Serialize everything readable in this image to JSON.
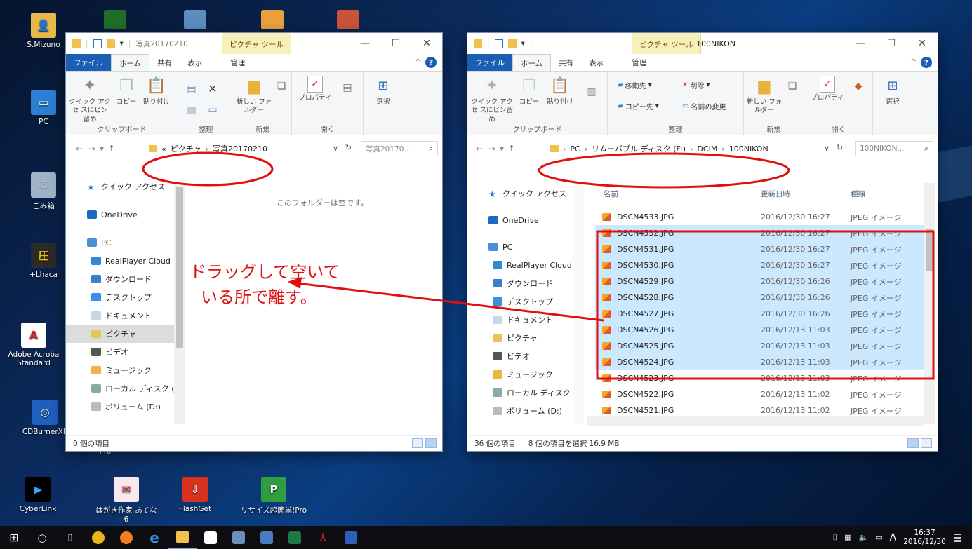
{
  "desktop": {
    "icons": [
      {
        "label": "S.Mizuno"
      },
      {
        "label": "PC"
      },
      {
        "label": "ごみ箱"
      },
      {
        "label": "+Lhaca"
      },
      {
        "label": "Adobe Acroba Standard"
      },
      {
        "label": "CDBurnerXP"
      },
      {
        "label": "CyberLink"
      },
      {
        "label": "はがき作家 あてな 6"
      },
      {
        "label": "FlashGet"
      },
      {
        "label": "リサイズ超簡単!Pro"
      }
    ],
    "icon_overlap_text": "Pro"
  },
  "left_window": {
    "title": "写真20170210",
    "context_tab": "ピクチャ ツール",
    "tabs": [
      "ファイル",
      "ホーム",
      "共有",
      "表示",
      "管理"
    ],
    "ribbon": {
      "pin": "クイック アクセ スにピン留め",
      "copy": "コピー",
      "paste": "貼り付け",
      "new_folder": "新しい フォルダー",
      "properties": "プロパティ",
      "select": "選択",
      "groups": [
        "クリップボード",
        "整理",
        "新規",
        "開く"
      ]
    },
    "breadcrumb": [
      "«",
      "ピクチャ",
      "写真20170210"
    ],
    "search_placeholder": "写真20170...",
    "empty_message": "このフォルダーは空です。",
    "status": "0 個の項目"
  },
  "right_window": {
    "title": "100NIKON",
    "context_tab": "ピクチャ ツール",
    "tabs": [
      "ファイル",
      "ホーム",
      "共有",
      "表示",
      "管理"
    ],
    "ribbon": {
      "pin": "クイック アクセ スにピン留め",
      "copy": "コピー",
      "paste": "貼り付け",
      "move_to": "移動先",
      "delete": "削除",
      "copy_to": "コピー先",
      "rename": "名前の変更",
      "new_folder": "新しい フォルダー",
      "properties": "プロパティ",
      "select": "選択",
      "groups": [
        "クリップボード",
        "整理",
        "新規",
        "開く"
      ]
    },
    "breadcrumb": [
      "PC",
      "リムーバブル ディスク (F:)",
      "DCIM",
      "100NIKON"
    ],
    "search_placeholder": "100NIKON...",
    "columns": [
      "名前",
      "更新日時",
      "種類"
    ],
    "files": [
      {
        "name": "DSCN4533.JPG",
        "date": "2016/12/30 16:27",
        "type": "JPEG イメージ",
        "selected": false
      },
      {
        "name": "DSCN4532.JPG",
        "date": "2016/12/30 16:27",
        "type": "JPEG イメージ",
        "selected": true
      },
      {
        "name": "DSCN4531.JPG",
        "date": "2016/12/30 16:27",
        "type": "JPEG イメージ",
        "selected": true
      },
      {
        "name": "DSCN4530.JPG",
        "date": "2016/12/30 16:27",
        "type": "JPEG イメージ",
        "selected": true
      },
      {
        "name": "DSCN4529.JPG",
        "date": "2016/12/30 16:26",
        "type": "JPEG イメージ",
        "selected": true
      },
      {
        "name": "DSCN4528.JPG",
        "date": "2016/12/30 16:26",
        "type": "JPEG イメージ",
        "selected": true
      },
      {
        "name": "DSCN4527.JPG",
        "date": "2016/12/30 16:26",
        "type": "JPEG イメージ",
        "selected": true
      },
      {
        "name": "DSCN4526.JPG",
        "date": "2016/12/13 11:03",
        "type": "JPEG イメージ",
        "selected": true
      },
      {
        "name": "DSCN4525.JPG",
        "date": "2016/12/13 11:03",
        "type": "JPEG イメージ",
        "selected": true
      },
      {
        "name": "DSCN4524.JPG",
        "date": "2016/12/13 11:03",
        "type": "JPEG イメージ",
        "selected": true
      },
      {
        "name": "DSCN4523.JPG",
        "date": "2016/12/13 11:03",
        "type": "JPEG イメージ",
        "selected": false
      },
      {
        "name": "DSCN4522.JPG",
        "date": "2016/12/13 11:02",
        "type": "JPEG イメージ",
        "selected": false
      },
      {
        "name": "DSCN4521.JPG",
        "date": "2016/12/13 11:02",
        "type": "JPEG イメージ",
        "selected": false
      }
    ],
    "status_count": "36 個の項目",
    "status_selection": "8 個の項目を選択 16.9 MB"
  },
  "nav_items": [
    "クイック アクセス",
    "OneDrive",
    "PC",
    "RealPlayer Cloud",
    "ダウンロード",
    "デスクトップ",
    "ドキュメント",
    "ピクチャ",
    "ビデオ",
    "ミュージック",
    "ローカル ディスク (C",
    "ボリューム (D:)"
  ],
  "annotation": {
    "line1": "ドラッグして空いて",
    "line2": "いる所で離す。",
    "color": "#e01010"
  },
  "taskbar": {
    "time": "16:37",
    "date": "2016/12/30",
    "ime": "A"
  }
}
